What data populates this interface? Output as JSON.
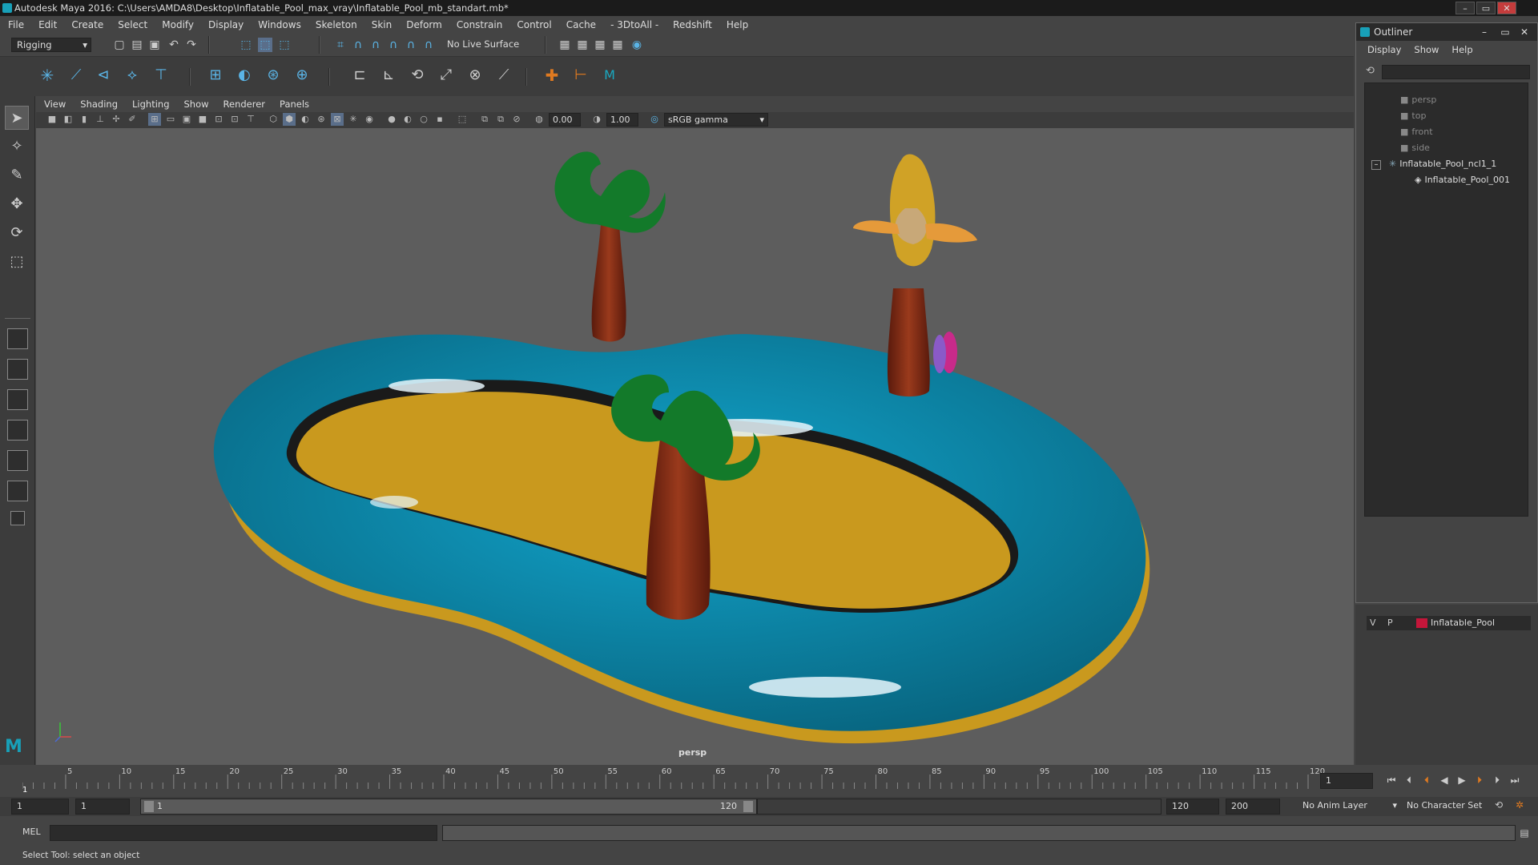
{
  "window": {
    "title": "Autodesk Maya 2016: C:\\Users\\AMDA8\\Desktop\\Inflatable_Pool_max_vray\\Inflatable_Pool_mb_standart.mb*",
    "min": "–",
    "max": "▭",
    "close": "✕"
  },
  "menubar": [
    "File",
    "Edit",
    "Create",
    "Select",
    "Modify",
    "Display",
    "Windows",
    "Skeleton",
    "Skin",
    "Deform",
    "Constrain",
    "Control",
    "Cache",
    "- 3DtoAll -",
    "Redshift",
    "Help"
  ],
  "status_line": {
    "mode": "Rigging",
    "live_surface": "No Live Surface"
  },
  "viewport": {
    "menu": [
      "View",
      "Shading",
      "Lighting",
      "Show",
      "Renderer",
      "Panels"
    ],
    "exposure": "0.00",
    "gamma": "1.00",
    "color_space": "sRGB gamma",
    "camera": "persp"
  },
  "outliner": {
    "title": "Outliner",
    "menu": [
      "Display",
      "Show",
      "Help"
    ],
    "items": [
      "persp",
      "top",
      "front",
      "side",
      "Inflatable_Pool_ncl1_1",
      "Inflatable_Pool_001"
    ],
    "min": "–",
    "max": "▭",
    "close": "✕"
  },
  "layers": {
    "v": "V",
    "p": "P",
    "name": "Inflatable_Pool",
    "color": "#c4163a"
  },
  "timeline": {
    "ticks": [
      "5",
      "10",
      "15",
      "20",
      "25",
      "30",
      "35",
      "40",
      "45",
      "50",
      "55",
      "60",
      "65",
      "70",
      "75",
      "80",
      "85",
      "90",
      "95",
      "100",
      "105",
      "110",
      "115",
      "120"
    ],
    "first": "1",
    "current_frame": "1"
  },
  "range": {
    "start": "1",
    "playback_start": "1",
    "slider_start": "1",
    "slider_end": "120",
    "playback_end": "120",
    "end": "200",
    "anim_layer": "No Anim Layer",
    "char_set": "No Character Set"
  },
  "cmdline": {
    "lang": "MEL"
  },
  "helpline": {
    "text": "Select Tool: select an object"
  },
  "colors": {
    "pool_blue": "#0e8db0",
    "floor_yellow": "#c9991e",
    "trunk": "#7a2a14",
    "leaves": "#137a2a"
  }
}
